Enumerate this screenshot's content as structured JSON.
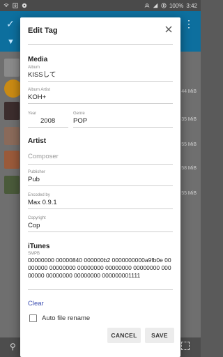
{
  "status_bar": {
    "battery": "100%",
    "time": "3:42"
  },
  "background": {
    "sizes": [
      "44 MiB",
      "35 MiB",
      "55 MiB",
      "58 MiB",
      "55 MiB"
    ]
  },
  "dialog": {
    "title": "Edit Tag",
    "sections": {
      "media": "Media",
      "itunes": "iTunes"
    },
    "fields": {
      "album": {
        "label": "Album",
        "value": "KISSして"
      },
      "album_artist": {
        "label": "Album Artist",
        "value": "KOH+"
      },
      "year": {
        "label": "Year",
        "value": "2008"
      },
      "genre": {
        "label": "Genre",
        "value": "POP"
      },
      "composer": {
        "placeholder": "Composer"
      },
      "publisher": {
        "label": "Publisher",
        "value": "Pub"
      },
      "encoded_by": {
        "label": "Encoded by",
        "value": "Max 0.9.1"
      },
      "copyright": {
        "label": "Copyright",
        "value": "Cop"
      },
      "smpb": {
        "label": "SMPB",
        "value": "00000000 00000840 000000b2 0000000000a9fb0e 00000000 00000000 00000000 00000000 00000000 00000000 00000000 00000000 000000001111"
      }
    },
    "clear_label": "Clear",
    "auto_rename_label": "Auto file rename",
    "auto_rename_checked": false,
    "cancel_label": "CANCEL",
    "save_label": "SAVE",
    "accent_color": "#3a4cb0"
  }
}
